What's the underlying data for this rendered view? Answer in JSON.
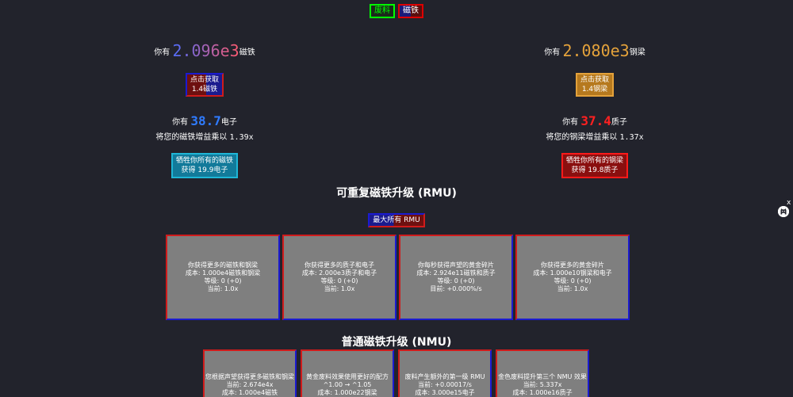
{
  "tabs": [
    "废料",
    "磁铁"
  ],
  "magnet": {
    "prefix": "你有",
    "amount": "2.096e3",
    "unit": "磁铁",
    "button_line1": "点击获取",
    "button_line2": "1.4磁铁"
  },
  "steel": {
    "prefix": "你有",
    "amount": "2.080e3",
    "unit": "钢梁",
    "button_line1": "点击获取",
    "button_line2": "1.4钢梁"
  },
  "electron": {
    "prefix": "你有",
    "amount": "38.7",
    "unit": "电子",
    "boost_text": "将您的磁铁增益乘以",
    "boost_value": "1.39x",
    "sacrifice_line1": "牺牲你所有的磁铁",
    "sacrifice_line2": "获得 19.9电子"
  },
  "proton": {
    "prefix": "你有",
    "amount": "37.4",
    "unit": "质子",
    "boost_text": "将您的钢梁增益乘以",
    "boost_value": "1.37x",
    "sacrifice_line1": "牺牲你所有的钢梁",
    "sacrifice_line2": "获得 19.8质子"
  },
  "rmu_section": {
    "title": "可重复磁铁升级 (RMU)",
    "max_all_button": "最大所有 RMU"
  },
  "rmu_cards": [
    {
      "desc": "你获得更多的磁铁和钢梁",
      "cost": "成本:  1.000e4磁铁和钢梁",
      "level": "等级:  0 (+0)",
      "current": "当前: 1.0x"
    },
    {
      "desc": "你获得更多的质子和电子",
      "cost": "成本:  2.000e3质子和电子",
      "level": "等级:  0 (+0)",
      "current": "当前: 1.0x"
    },
    {
      "desc": "你每秒获得声望的黄金碎片",
      "cost": "成本:  2.924e11磁铁和质子",
      "level": "等级:  0 (+0)",
      "current": "目前: +0.000%/s"
    },
    {
      "desc": "你获得更多的黄金碎片",
      "cost": "成本:  1.000e10钢梁和电子",
      "level": "等级:  0 (+0)",
      "current": "当前: 1.0x"
    }
  ],
  "nmu_section": {
    "title": "普通磁铁升级 (NMU)"
  },
  "nmu_cards": [
    {
      "desc": "您根据声望获得更多磁铁和钢梁",
      "current": "当前: 2.674e4x",
      "cost": "成本:  1.000e4磁铁"
    },
    {
      "desc": "黄金废料效果使用更好的配方",
      "current": "^1.00 → ^1.05",
      "cost": "成本:  1.000e22钢梁"
    },
    {
      "desc": "废料产生额外的第一级 RMU",
      "current": "当前: +0.00017/s",
      "cost": "成本:  3.000e15电子"
    },
    {
      "desc": "金色废料提升第三个 NMU 效果",
      "current": "当前: 5.337x",
      "cost": "成本:  1.000e16质子"
    }
  ],
  "misc": {
    "close_label": "x"
  }
}
